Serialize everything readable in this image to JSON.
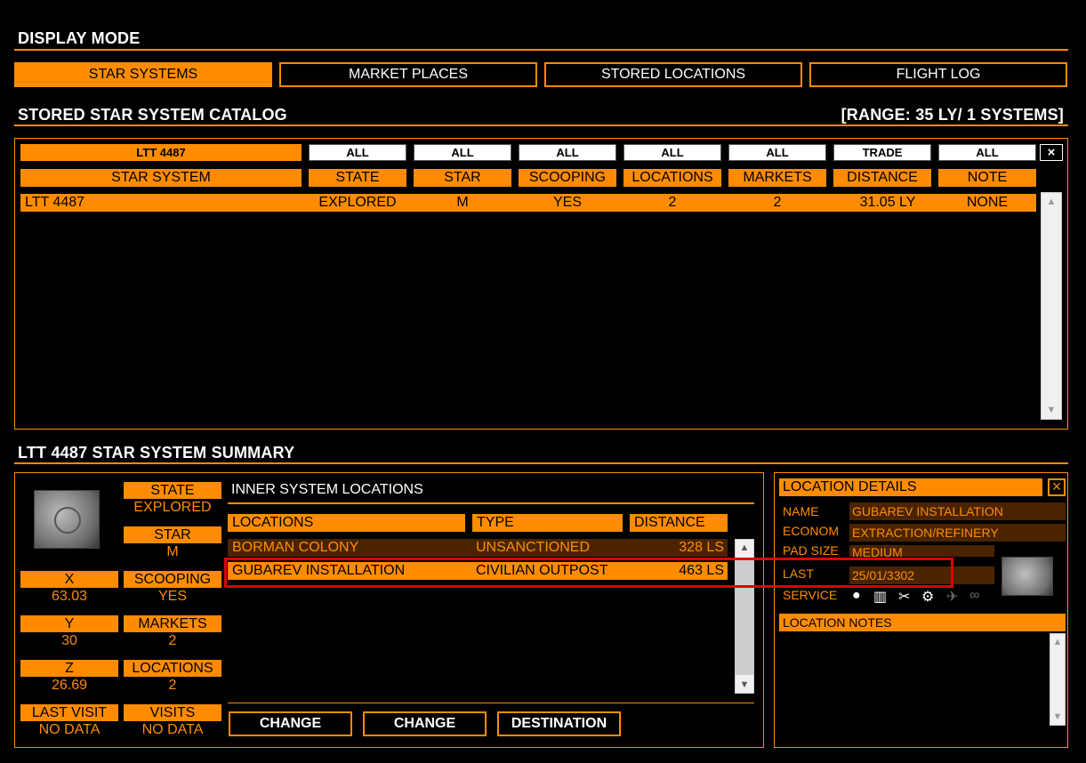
{
  "display_mode": {
    "title": "DISPLAY MODE",
    "tabs": [
      {
        "label": "STAR SYSTEMS",
        "active": true
      },
      {
        "label": "MARKET PLACES",
        "active": false
      },
      {
        "label": "STORED LOCATIONS",
        "active": false
      },
      {
        "label": "FLIGHT LOG",
        "active": false
      }
    ]
  },
  "catalog": {
    "title": "STORED STAR SYSTEM CATALOG",
    "range": "[RANGE: 35 LY/ 1 SYSTEMS]",
    "filters": [
      "LTT 4487",
      "ALL",
      "ALL",
      "ALL",
      "ALL",
      "ALL",
      "TRADE",
      "ALL"
    ],
    "clear_label": "×",
    "columns": [
      "STAR SYSTEM",
      "STATE",
      "STAR",
      "SCOOPING",
      "LOCATIONS",
      "MARKETS",
      "DISTANCE",
      "NOTE"
    ],
    "rows": [
      {
        "system": "LTT 4487",
        "state": "EXPLORED",
        "star": "M",
        "scooping": "YES",
        "locations": "2",
        "markets": "2",
        "distance": "31.05 LY",
        "note": "NONE"
      }
    ]
  },
  "summary": {
    "title": "LTT 4487 STAR SYSTEM SUMMARY",
    "state_label": "STATE",
    "state_value": "EXPLORED",
    "star_label": "STAR",
    "star_value": "M",
    "x_label": "X",
    "x_value": "63.03",
    "scooping_label": "SCOOPING",
    "scooping_value": "YES",
    "y_label": "Y",
    "y_value": "30",
    "markets_label": "MARKETS",
    "markets_value": "2",
    "z_label": "Z",
    "z_value": "26.69",
    "locations_label": "LOCATIONS",
    "locations_value": "2",
    "last_visit_label": "LAST VISIT",
    "last_visit_value": "NO DATA",
    "visits_label": "VISITS",
    "visits_value": "NO DATA"
  },
  "inner": {
    "title": "INNER SYSTEM LOCATIONS",
    "columns": [
      "LOCATIONS",
      "TYPE",
      "DISTANCE"
    ],
    "rows": [
      {
        "name": "BORMAN COLONY",
        "type": "UNSANCTIONED",
        "distance": "328 LS",
        "selected": false
      },
      {
        "name": "GUBAREV INSTALLATION",
        "type": "CIVILIAN OUTPOST",
        "distance": "463 LS",
        "selected": true
      }
    ],
    "buttons": [
      "CHANGE",
      "CHANGE",
      "DESTINATION"
    ]
  },
  "details": {
    "title": "LOCATION DETAILS",
    "close_label": "×",
    "name_label": "NAME",
    "name_value": "GUBAREV INSTALLATION",
    "econom_label": "ECONOM",
    "econom_value": "EXTRACTION/REFINERY",
    "pad_label": "PAD SIZE",
    "pad_value": "MEDIUM",
    "last_label": "LAST",
    "last_value": "25/01/3302",
    "service_label": "SERVICE",
    "services": [
      {
        "icon": "fuel-drop-icon",
        "glyph": "💧",
        "active": true
      },
      {
        "icon": "market-icon",
        "glyph": "▥",
        "active": true
      },
      {
        "icon": "repair-tools-icon",
        "glyph": "✂",
        "active": true
      },
      {
        "icon": "rearm-gear-icon",
        "glyph": "⚙",
        "active": true
      },
      {
        "icon": "shipyard-icon",
        "glyph": "✈",
        "active": false
      },
      {
        "icon": "outfitting-icon",
        "glyph": "∞",
        "active": false
      }
    ],
    "notes_label": "LOCATION NOTES"
  },
  "colors": {
    "accent": "#ff8c00",
    "dark_accent": "#4a2400",
    "highlight": "#e00000"
  }
}
